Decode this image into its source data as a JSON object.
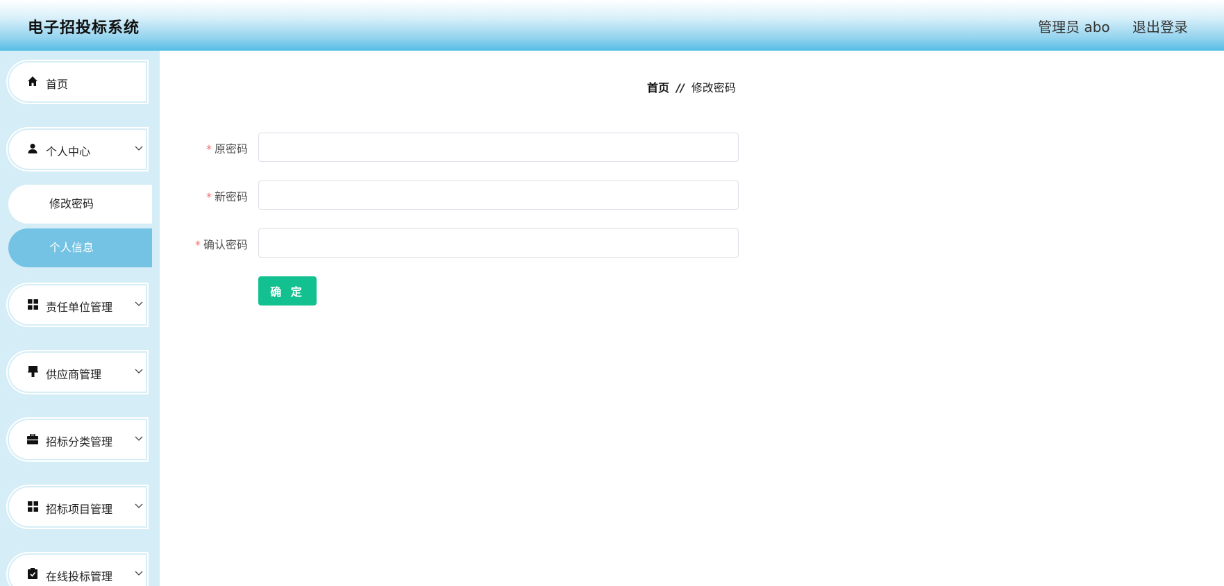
{
  "header": {
    "title": "电子招投标系统",
    "user_label": "管理员 abo",
    "logout_label": "退出登录"
  },
  "sidebar": {
    "items": [
      {
        "label": "首页",
        "icon": "home-icon",
        "has_arrow": false
      },
      {
        "label": "个人中心",
        "icon": "user-icon",
        "has_arrow": true
      },
      {
        "label": "责任单位管理",
        "icon": "grid-icon",
        "has_arrow": true
      },
      {
        "label": "供应商管理",
        "icon": "brush-icon",
        "has_arrow": true
      },
      {
        "label": "招标分类管理",
        "icon": "briefcase-icon",
        "has_arrow": true
      },
      {
        "label": "招标项目管理",
        "icon": "grid-icon",
        "has_arrow": true
      },
      {
        "label": "在线投标管理",
        "icon": "clipboard-icon",
        "has_arrow": true
      }
    ],
    "sub_items": [
      {
        "label": "修改密码",
        "active": false
      },
      {
        "label": "个人信息",
        "active": true
      }
    ]
  },
  "breadcrumb": {
    "home": "首页",
    "separator": "//",
    "current": "修改密码"
  },
  "form": {
    "required_mark": "*",
    "fields": [
      {
        "label": "原密码",
        "value": ""
      },
      {
        "label": "新密码",
        "value": ""
      },
      {
        "label": "确认密码",
        "value": ""
      }
    ],
    "submit_label": "确 定"
  },
  "colors": {
    "header_gradient_end": "#55bde6",
    "sidebar_bg": "#d5edf7",
    "submenu_active": "#74c3e4",
    "button": "#13c08f",
    "required": "#f56c6c"
  }
}
